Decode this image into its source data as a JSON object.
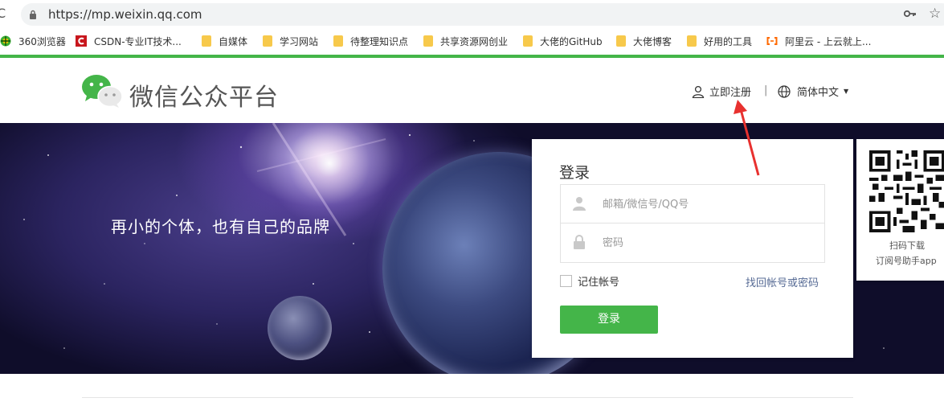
{
  "browser": {
    "url": "https://mp.weixin.qq.com",
    "bookmarks": [
      {
        "label": "360浏览器",
        "icon": "360-browser-icon"
      },
      {
        "label": "CSDN-专业IT技术...",
        "icon": "csdn-icon"
      },
      {
        "label": "自媒体",
        "icon": "folder-icon"
      },
      {
        "label": "学习网站",
        "icon": "folder-icon"
      },
      {
        "label": "待整理知识点",
        "icon": "folder-icon"
      },
      {
        "label": "共享资源网创业",
        "icon": "folder-icon"
      },
      {
        "label": "大佬的GitHub",
        "icon": "folder-icon"
      },
      {
        "label": "大佬博客",
        "icon": "folder-icon"
      },
      {
        "label": "好用的工具",
        "icon": "folder-icon"
      },
      {
        "label": "阿里云 - 上云就上...",
        "icon": "aliyun-icon"
      }
    ]
  },
  "header": {
    "title": "微信公众平台",
    "register_label": "立即注册",
    "separator": "|",
    "language_label": "简体中文",
    "caret": "▼"
  },
  "banner": {
    "slogan": "再小的个体，也有自己的品牌"
  },
  "login": {
    "title": "登录",
    "account_placeholder": "邮箱/微信号/QQ号",
    "password_placeholder": "密码",
    "remember_label": "记住帐号",
    "forgot_label": "找回帐号或密码",
    "submit_label": "登录"
  },
  "qr": {
    "line1": "扫码下载",
    "line2": "订阅号助手app"
  },
  "colors": {
    "accent_green": "#44b549",
    "link_blue": "#576b95",
    "annotation_red": "#e8312f"
  }
}
